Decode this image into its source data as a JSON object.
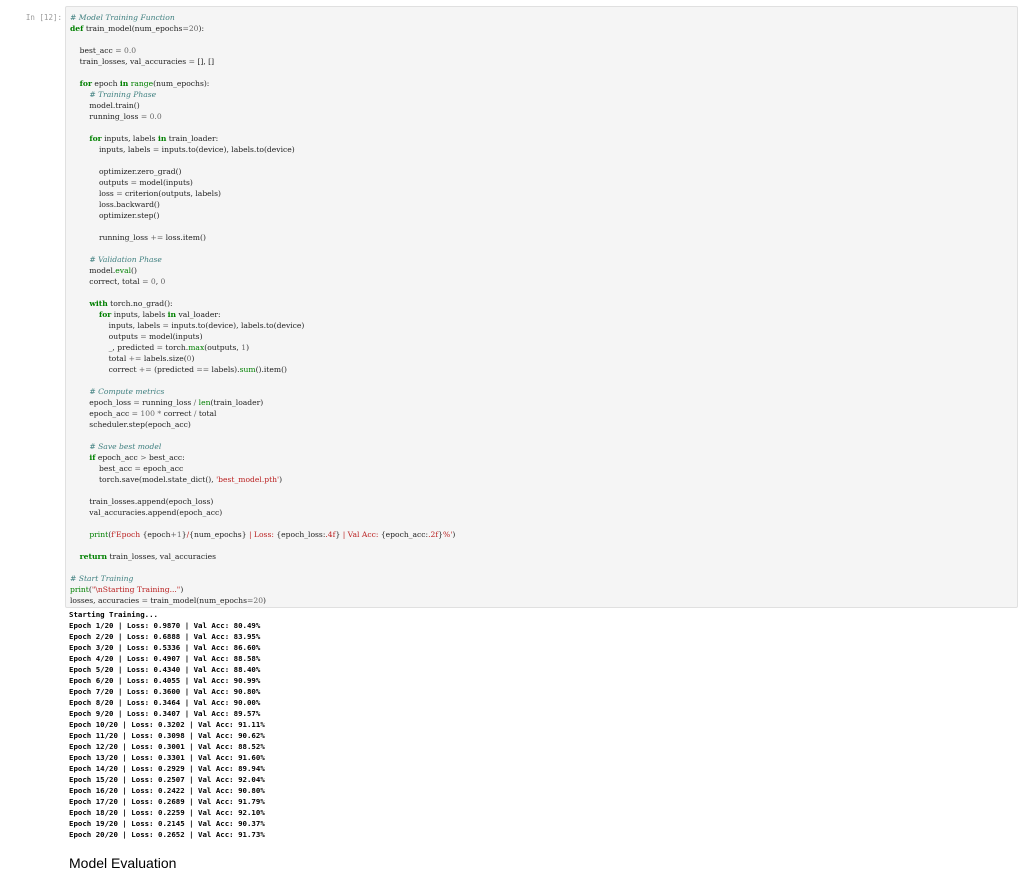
{
  "cell": {
    "prompt": "In [12]:",
    "code_lines": [
      [
        [
          "cm",
          "# Model Training Function"
        ]
      ],
      [
        [
          "kw",
          "def"
        ],
        [
          "t",
          " train_model(num_epochs"
        ],
        [
          "op",
          "="
        ],
        [
          "num",
          "20"
        ],
        [
          "t",
          "):"
        ]
      ],
      [
        [
          "t",
          ""
        ]
      ],
      [
        [
          "t",
          "    best_acc "
        ],
        [
          "op",
          "="
        ],
        [
          "num",
          " 0.0"
        ]
      ],
      [
        [
          "t",
          "    train_losses, val_accuracies "
        ],
        [
          "op",
          "="
        ],
        [
          "t",
          " [], []"
        ]
      ],
      [
        [
          "t",
          ""
        ]
      ],
      [
        [
          "t",
          "    "
        ],
        [
          "kw",
          "for"
        ],
        [
          "t",
          " epoch "
        ],
        [
          "kw",
          "in"
        ],
        [
          "t",
          " "
        ],
        [
          "bi",
          "range"
        ],
        [
          "t",
          "(num_epochs):"
        ]
      ],
      [
        [
          "t",
          "        "
        ],
        [
          "cm",
          "# Training Phase"
        ]
      ],
      [
        [
          "t",
          "        model.train()"
        ]
      ],
      [
        [
          "t",
          "        running_loss "
        ],
        [
          "op",
          "="
        ],
        [
          "num",
          " 0.0"
        ]
      ],
      [
        [
          "t",
          ""
        ]
      ],
      [
        [
          "t",
          "        "
        ],
        [
          "kw",
          "for"
        ],
        [
          "t",
          " inputs, labels "
        ],
        [
          "kw",
          "in"
        ],
        [
          "t",
          " train_loader:"
        ]
      ],
      [
        [
          "t",
          "            inputs, labels "
        ],
        [
          "op",
          "="
        ],
        [
          "t",
          " inputs.to(device), labels.to(device)"
        ]
      ],
      [
        [
          "t",
          ""
        ]
      ],
      [
        [
          "t",
          "            optimizer.zero_grad()"
        ]
      ],
      [
        [
          "t",
          "            outputs "
        ],
        [
          "op",
          "="
        ],
        [
          "t",
          " model(inputs)"
        ]
      ],
      [
        [
          "t",
          "            loss "
        ],
        [
          "op",
          "="
        ],
        [
          "t",
          " criterion(outputs, labels)"
        ]
      ],
      [
        [
          "t",
          "            loss.backward()"
        ]
      ],
      [
        [
          "t",
          "            optimizer.step()"
        ]
      ],
      [
        [
          "t",
          ""
        ]
      ],
      [
        [
          "t",
          "            running_loss "
        ],
        [
          "op",
          "+="
        ],
        [
          "t",
          " loss.item()"
        ]
      ],
      [
        [
          "t",
          ""
        ]
      ],
      [
        [
          "t",
          "        "
        ],
        [
          "cm",
          "# Validation Phase"
        ]
      ],
      [
        [
          "t",
          "        model."
        ],
        [
          "bi",
          "eval"
        ],
        [
          "t",
          "()"
        ]
      ],
      [
        [
          "t",
          "        correct, total "
        ],
        [
          "op",
          "="
        ],
        [
          "num",
          " 0"
        ],
        [
          "t",
          ", "
        ],
        [
          "num",
          "0"
        ]
      ],
      [
        [
          "t",
          ""
        ]
      ],
      [
        [
          "t",
          "        "
        ],
        [
          "kw",
          "with"
        ],
        [
          "t",
          " torch.no_grad():"
        ]
      ],
      [
        [
          "t",
          "            "
        ],
        [
          "kw",
          "for"
        ],
        [
          "t",
          " inputs, labels "
        ],
        [
          "kw",
          "in"
        ],
        [
          "t",
          " val_loader:"
        ]
      ],
      [
        [
          "t",
          "                inputs, labels "
        ],
        [
          "op",
          "="
        ],
        [
          "t",
          " inputs.to(device), labels.to(device)"
        ]
      ],
      [
        [
          "t",
          "                outputs "
        ],
        [
          "op",
          "="
        ],
        [
          "t",
          " model(inputs)"
        ]
      ],
      [
        [
          "t",
          "                _, predicted "
        ],
        [
          "op",
          "="
        ],
        [
          "t",
          " torch."
        ],
        [
          "bi",
          "max"
        ],
        [
          "t",
          "(outputs, "
        ],
        [
          "num",
          "1"
        ],
        [
          "t",
          ")"
        ]
      ],
      [
        [
          "t",
          "                total "
        ],
        [
          "op",
          "+="
        ],
        [
          "t",
          " labels.size("
        ],
        [
          "num",
          "0"
        ],
        [
          "t",
          ")"
        ]
      ],
      [
        [
          "t",
          "                correct "
        ],
        [
          "op",
          "+="
        ],
        [
          "t",
          " (predicted "
        ],
        [
          "op",
          "=="
        ],
        [
          "t",
          " labels)."
        ],
        [
          "bi",
          "sum"
        ],
        [
          "t",
          "().item()"
        ]
      ],
      [
        [
          "t",
          ""
        ]
      ],
      [
        [
          "t",
          "        "
        ],
        [
          "cm",
          "# Compute metrics"
        ]
      ],
      [
        [
          "t",
          "        epoch_loss "
        ],
        [
          "op",
          "="
        ],
        [
          "t",
          " running_loss "
        ],
        [
          "op",
          "/"
        ],
        [
          "t",
          " "
        ],
        [
          "bi",
          "len"
        ],
        [
          "t",
          "(train_loader)"
        ]
      ],
      [
        [
          "t",
          "        epoch_acc "
        ],
        [
          "op",
          "="
        ],
        [
          "num",
          " 100"
        ],
        [
          "t",
          " "
        ],
        [
          "op",
          "*"
        ],
        [
          "t",
          " correct "
        ],
        [
          "op",
          "/"
        ],
        [
          "t",
          " total"
        ]
      ],
      [
        [
          "t",
          "        scheduler.step(epoch_acc)"
        ]
      ],
      [
        [
          "t",
          ""
        ]
      ],
      [
        [
          "t",
          "        "
        ],
        [
          "cm",
          "# Save best model"
        ]
      ],
      [
        [
          "t",
          "        "
        ],
        [
          "kw",
          "if"
        ],
        [
          "t",
          " epoch_acc "
        ],
        [
          "op",
          ">"
        ],
        [
          "t",
          " best_acc:"
        ]
      ],
      [
        [
          "t",
          "            best_acc "
        ],
        [
          "op",
          "="
        ],
        [
          "t",
          " epoch_acc"
        ]
      ],
      [
        [
          "t",
          "            torch.save(model.state_dict(), "
        ],
        [
          "str",
          "'best_model.pth'"
        ],
        [
          "t",
          ")"
        ]
      ],
      [
        [
          "t",
          ""
        ]
      ],
      [
        [
          "t",
          "        train_losses.append(epoch_loss)"
        ]
      ],
      [
        [
          "t",
          "        val_accuracies.append(epoch_acc)"
        ]
      ],
      [
        [
          "t",
          ""
        ]
      ],
      [
        [
          "t",
          "        "
        ],
        [
          "bi",
          "print"
        ],
        [
          "t",
          "("
        ],
        [
          "str",
          "f'Epoch "
        ],
        [
          "t",
          "{epoch"
        ],
        [
          "op",
          "+"
        ],
        [
          "num",
          "1"
        ],
        [
          "t",
          "}"
        ],
        [
          "str",
          "/"
        ],
        [
          "t",
          "{num_epochs}"
        ],
        [
          "str",
          " | Loss: "
        ],
        [
          "t",
          "{epoch_loss:"
        ],
        [
          "str",
          ".4f"
        ],
        [
          "t",
          "}"
        ],
        [
          "str",
          " | Val Acc: "
        ],
        [
          "t",
          "{epoch_acc:"
        ],
        [
          "str",
          ".2f"
        ],
        [
          "t",
          "}"
        ],
        [
          "str",
          "%'"
        ],
        [
          "t",
          ")"
        ]
      ],
      [
        [
          "t",
          ""
        ]
      ],
      [
        [
          "t",
          "    "
        ],
        [
          "kw",
          "return"
        ],
        [
          "t",
          " train_losses, val_accuracies"
        ]
      ],
      [
        [
          "t",
          ""
        ]
      ],
      [
        [
          "cm",
          "# Start Training"
        ]
      ],
      [
        [
          "bi",
          "print"
        ],
        [
          "t",
          "("
        ],
        [
          "str",
          "\"\\nStarting Training...\""
        ],
        [
          "t",
          ")"
        ]
      ],
      [
        [
          "t",
          "losses, accuracies "
        ],
        [
          "op",
          "="
        ],
        [
          "t",
          " train_model(num_epochs"
        ],
        [
          "op",
          "="
        ],
        [
          "num",
          "20"
        ],
        [
          "t",
          ")"
        ]
      ]
    ]
  },
  "output_lines": [
    "Starting Training...",
    "Epoch 1/20 | Loss: 0.9870 | Val Acc: 80.49%",
    "Epoch 2/20 | Loss: 0.6888 | Val Acc: 83.95%",
    "Epoch 3/20 | Loss: 0.5336 | Val Acc: 86.60%",
    "Epoch 4/20 | Loss: 0.4907 | Val Acc: 88.58%",
    "Epoch 5/20 | Loss: 0.4340 | Val Acc: 88.40%",
    "Epoch 6/20 | Loss: 0.4055 | Val Acc: 90.99%",
    "Epoch 7/20 | Loss: 0.3600 | Val Acc: 90.80%",
    "Epoch 8/20 | Loss: 0.3464 | Val Acc: 90.00%",
    "Epoch 9/20 | Loss: 0.3407 | Val Acc: 89.57%",
    "Epoch 10/20 | Loss: 0.3202 | Val Acc: 91.11%",
    "Epoch 11/20 | Loss: 0.3098 | Val Acc: 90.62%",
    "Epoch 12/20 | Loss: 0.3001 | Val Acc: 88.52%",
    "Epoch 13/20 | Loss: 0.3301 | Val Acc: 91.60%",
    "Epoch 14/20 | Loss: 0.2929 | Val Acc: 89.94%",
    "Epoch 15/20 | Loss: 0.2507 | Val Acc: 92.04%",
    "Epoch 16/20 | Loss: 0.2422 | Val Acc: 90.80%",
    "Epoch 17/20 | Loss: 0.2689 | Val Acc: 91.79%",
    "Epoch 18/20 | Loss: 0.2259 | Val Acc: 92.10%",
    "Epoch 19/20 | Loss: 0.2145 | Val Acc: 90.37%",
    "Epoch 20/20 | Loss: 0.2652 | Val Acc: 91.73%"
  ],
  "markdown_heading": "Model Evaluation",
  "colors": {
    "keyword": "#008000",
    "comment": "#408080",
    "string": "#ba2121",
    "number": "#666666",
    "cell_background": "#f5f5f5",
    "cell_border": "#e0e0e0",
    "prompt": "#9a9a9a"
  }
}
